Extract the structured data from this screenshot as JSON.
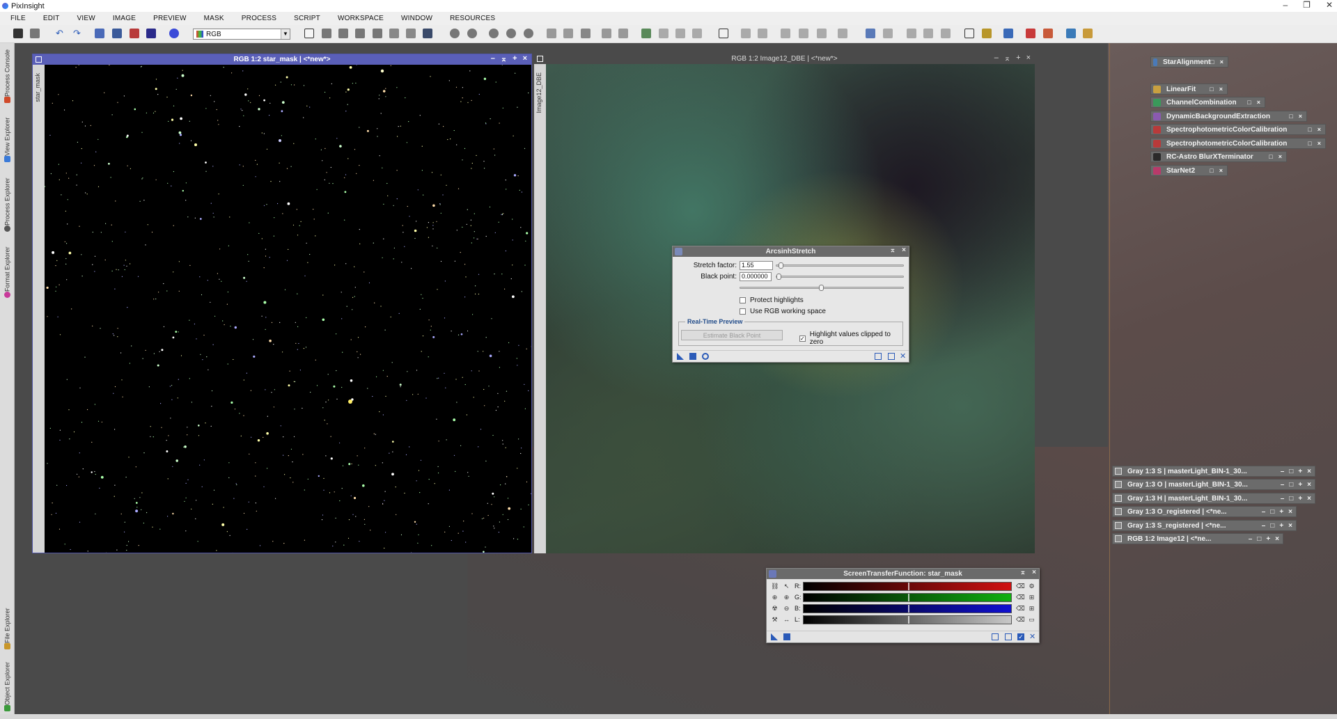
{
  "app": {
    "title": "PixInsight",
    "window_controls": [
      "–",
      "❐",
      "✕"
    ]
  },
  "menu": [
    "FILE",
    "EDIT",
    "VIEW",
    "IMAGE",
    "PREVIEW",
    "MASK",
    "PROCESS",
    "SCRIPT",
    "WORKSPACE",
    "WINDOW",
    "RESOURCES"
  ],
  "toolbar": {
    "color_mode": "RGB"
  },
  "left_tabs": [
    "Process Console",
    "View Explorer",
    "Process Explorer",
    "Format Explorer",
    "File Explorer",
    "Object Explorer"
  ],
  "image_windows": [
    {
      "title": "RGB 1:2 star_mask | <*new*>",
      "side_label": "star_mask"
    },
    {
      "title": "RGB 1:2 Image12_DBE | <*new*>",
      "side_label": "Image12_DBE"
    }
  ],
  "process_icons": [
    {
      "label": "StarAlignment",
      "color": "#4a7ab8"
    },
    {
      "label": "LinearFit",
      "color": "#c8a040"
    },
    {
      "label": "ChannelCombination",
      "color": "#3a9a5a"
    },
    {
      "label": "DynamicBackgroundExtraction",
      "color": "#8a5ab0"
    },
    {
      "label": "SpectrophotometricColorCalibration",
      "color": "#b83a3a"
    },
    {
      "label": "SpectrophotometricColorCalibration",
      "color": "#b83a3a"
    },
    {
      "label": "RC-Astro BlurXTerminator",
      "color": "#2a2a2a"
    },
    {
      "label": "StarNet2",
      "color": "#b83a6a"
    }
  ],
  "iconized_windows": [
    {
      "label": "Gray 1:3 S | masterLight_BIN-1_30..."
    },
    {
      "label": "Gray 1:3 O | masterLight_BIN-1_30..."
    },
    {
      "label": "Gray 1:3 H | masterLight_BIN-1_30..."
    },
    {
      "label": "Gray 1:3 O_registered | <*ne..."
    },
    {
      "label": "Gray 1:3 S_registered | <*ne..."
    },
    {
      "label": "RGB 1:2 Image12 | <*ne..."
    }
  ],
  "arcsinh": {
    "title": "ArcsinhStretch",
    "stretch_label": "Stretch factor:",
    "stretch_value": "1.55",
    "stretch_fraction": 0.02,
    "black_label": "Black point:",
    "black_value": "0.000000",
    "black_fraction": 0.0,
    "coarse_fraction": 0.5,
    "protect_highlights": "Protect highlights",
    "protect_checked": false,
    "use_rgb": "Use RGB working space",
    "use_rgb_checked": false,
    "rtp_title": "Real-Time Preview",
    "estimate_button": "Estimate Black Point",
    "highlight_clipped": "Highlight values clipped to zero",
    "highlight_checked": true
  },
  "stf": {
    "title": "ScreenTransferFunction: star_mask",
    "channels": [
      {
        "label": "R:",
        "color": "#d01010"
      },
      {
        "label": "G:",
        "color": "#10b010"
      },
      {
        "label": "B:",
        "color": "#1010d0"
      },
      {
        "label": "L:",
        "color": "#c8c8c8"
      }
    ]
  }
}
